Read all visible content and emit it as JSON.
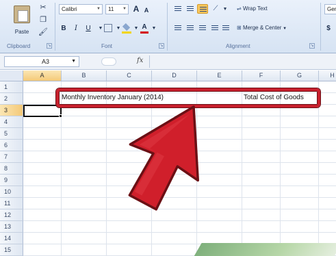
{
  "ribbon": {
    "clipboard": {
      "paste_label": "Paste",
      "group_label": "Clipboard"
    },
    "font": {
      "font_name": "Calibri",
      "font_size": "11",
      "grow_label": "A",
      "shrink_label": "A",
      "bold_label": "B",
      "italic_label": "I",
      "underline_label": "U",
      "font_color_label": "A",
      "group_label": "Font"
    },
    "alignment": {
      "wrap_text_label": "Wrap Text",
      "merge_center_label": "Merge & Center",
      "group_label": "Alignment"
    },
    "number": {
      "format_label": "Gen",
      "currency_label": "$"
    }
  },
  "formula_bar": {
    "name_box": "A3",
    "fx_label": "fx"
  },
  "grid": {
    "columns": [
      "A",
      "B",
      "C",
      "D",
      "E",
      "F",
      "G",
      "H"
    ],
    "rows": [
      "1",
      "2",
      "3",
      "4",
      "5",
      "6",
      "7",
      "8",
      "9",
      "10",
      "11",
      "12",
      "13",
      "14",
      "15"
    ],
    "selected_column": "A",
    "selected_row": "3",
    "cells": {
      "B2": "Monthly Inventory January (2014)",
      "F2": "Total Cost of Goods"
    }
  },
  "annotation": {
    "color": "#c8202d"
  }
}
